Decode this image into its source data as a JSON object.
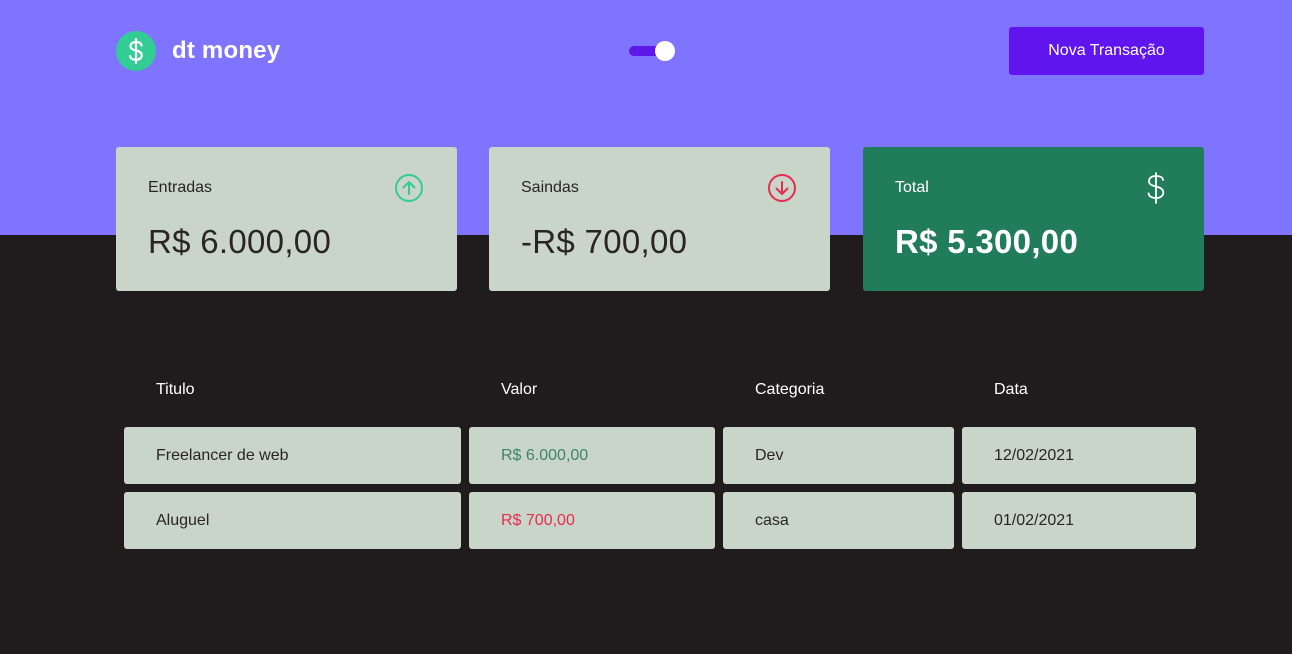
{
  "header": {
    "app_name": "dt money",
    "logo_icon": "dollar-icon",
    "theme_toggle": {
      "state": "on"
    },
    "new_transaction_label": "Nova Transação"
  },
  "summary": {
    "income": {
      "label": "Entradas",
      "value": "R$ 6.000,00",
      "icon": "arrow-up-circle-icon",
      "icon_color": "#33cc95"
    },
    "outcome": {
      "label": "Saindas",
      "value": "-R$ 700,00",
      "icon": "arrow-down-circle-icon",
      "icon_color": "#e52e4d"
    },
    "total": {
      "label": "Total",
      "value": "R$ 5.300,00",
      "icon": "dollar-icon"
    }
  },
  "table": {
    "headers": [
      "Titulo",
      "Valor",
      "Categoria",
      "Data"
    ],
    "rows": [
      [
        "Freelancer de web",
        "R$ 6.000,00",
        "Dev",
        "12/02/2021"
      ],
      [
        "Aluguel",
        "R$ 700,00",
        "casa",
        "01/02/2021"
      ]
    ]
  },
  "colors": {
    "hero_bg": "#7f74ff",
    "page_bg": "#201c1d",
    "card_bg": "#c9d5c8",
    "total_bg": "#217c5b",
    "button_bg": "#6014ee",
    "income": "#3e8565",
    "outcome": "#e52e4d"
  }
}
